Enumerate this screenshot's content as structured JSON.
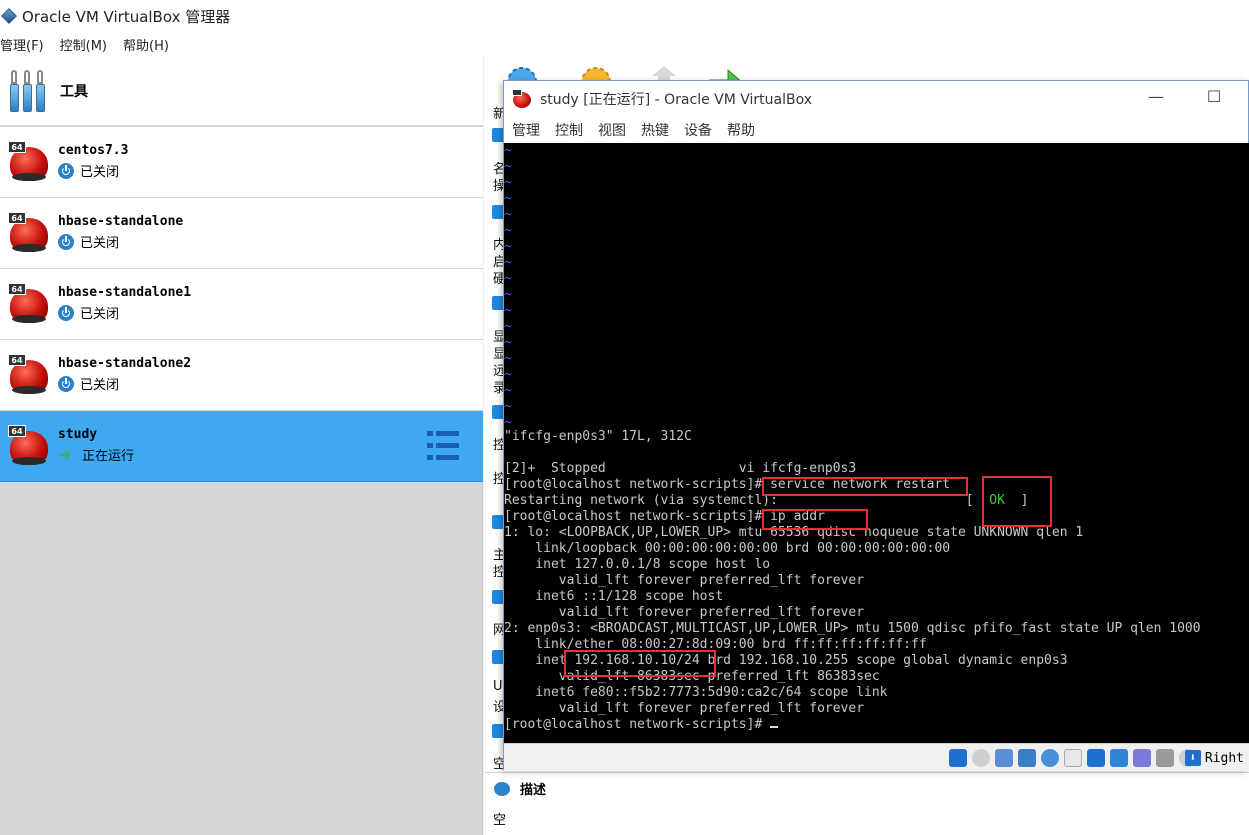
{
  "main_window": {
    "title": "Oracle VM VirtualBox 管理器",
    "menu": [
      "管理(F)",
      "控制(M)",
      "帮助(H)"
    ]
  },
  "sidebar": {
    "tools_label": "工具",
    "vms": [
      {
        "name": "centos7.3",
        "state": "已关闭",
        "badge": "64"
      },
      {
        "name": "hbase-standalone",
        "state": "已关闭",
        "badge": "64"
      },
      {
        "name": "hbase-standalone1",
        "state": "已关闭",
        "badge": "64"
      },
      {
        "name": "hbase-standalone2",
        "state": "已关闭",
        "badge": "64"
      },
      {
        "name": "study",
        "state": "正在运行",
        "badge": "64"
      }
    ]
  },
  "details": {
    "fragments": [
      "新",
      "名",
      "操",
      "内",
      "启",
      "硬",
      "显",
      "显",
      "远",
      "录",
      "控",
      "控",
      "主",
      "控",
      "网",
      "U",
      "设",
      "空"
    ],
    "description_header": "描述",
    "description_value": "空"
  },
  "vm_window": {
    "title": "study [正在运行] - Oracle VM VirtualBox",
    "menu": [
      "管理",
      "控制",
      "视图",
      "热键",
      "设备",
      "帮助"
    ],
    "console_lines": [
      "\"ifcfg-enp0s3\" 17L, 312C",
      "",
      "[2]+  Stopped                 vi ifcfg-enp0s3",
      "[root@localhost network-scripts]# service network restart",
      "Restarting network (via systemctl):                        [  OK  ]",
      "[root@localhost network-scripts]# ip addr",
      "1: lo: <LOOPBACK,UP,LOWER_UP> mtu 65536 qdisc noqueue state UNKNOWN qlen 1",
      "    link/loopback 00:00:00:00:00:00 brd 00:00:00:00:00:00",
      "    inet 127.0.0.1/8 scope host lo",
      "       valid_lft forever preferred_lft forever",
      "    inet6 ::1/128 scope host",
      "       valid_lft forever preferred_lft forever",
      "2: enp0s3: <BROADCAST,MULTICAST,UP,LOWER_UP> mtu 1500 qdisc pfifo_fast state UP qlen 1000",
      "    link/ether 08:00:27:8d:09:00 brd ff:ff:ff:ff:ff:ff",
      "    inet 192.168.10.10/24 brd 192.168.10.255 scope global dynamic enp0s3",
      "       valid_lft 86383sec preferred_lft 86383sec",
      "    inet6 fe80::f5b2:7773:5d90:ca2c/64 scope link",
      "       valid_lft forever preferred_lft forever",
      "[root@localhost network-scripts]# "
    ],
    "host_key": "Right"
  },
  "colors": {
    "selected_row": "#3fa9f0",
    "console_bg": "#000000",
    "highlight_box": "#e03333",
    "ok_text": "#3ec83e",
    "tilde": "#3c57d8"
  }
}
